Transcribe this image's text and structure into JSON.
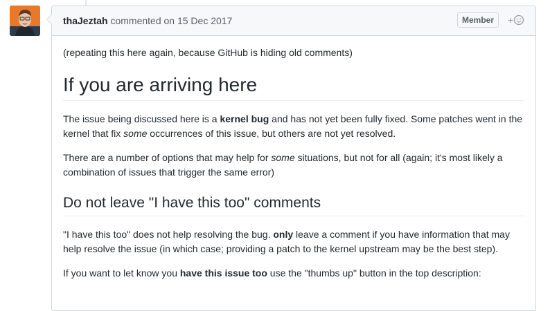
{
  "comment": {
    "author": "thaJeztah",
    "action": "commented on",
    "date": "15 Dec 2017",
    "badge": "Member",
    "reaction_icon": "smiley-add-icon",
    "reaction_plus": "+"
  },
  "body": {
    "intro": "(repeating this here again, because GitHub is hiding old comments)",
    "heading1": "If you are arriving here",
    "p1": [
      {
        "t": "The issue being discussed here is a "
      },
      {
        "t": "kernel bug",
        "style": "bold"
      },
      {
        "t": " and has not yet been fully fixed. Some patches went in the kernel that fix "
      },
      {
        "t": "some",
        "style": "italic"
      },
      {
        "t": " occurrences of this issue, but others are not yet resolved."
      }
    ],
    "p2": [
      {
        "t": "There are a number of options that may help for "
      },
      {
        "t": "some",
        "style": "italic"
      },
      {
        "t": " situations, but not for all (again; it's most likely a combination of issues that trigger the same error)"
      }
    ],
    "heading2": "Do not leave \"I have this too\" comments",
    "p3": [
      {
        "t": "\"I have this too\" does not help resolving the bug. "
      },
      {
        "t": "only",
        "style": "bold"
      },
      {
        "t": " leave a comment if you have information that may help resolve the issue (in which case; providing a patch to the kernel upstream may be the best step)."
      }
    ],
    "p4": [
      {
        "t": "If you want to let know you "
      },
      {
        "t": "have this issue too",
        "style": "bold"
      },
      {
        "t": " use the \"thumbs up\" button in the top description:"
      }
    ]
  },
  "colors": {
    "avatar_bg": "#e8782a",
    "header_bg": "#f6f8fa",
    "border": "#d1d5da"
  }
}
